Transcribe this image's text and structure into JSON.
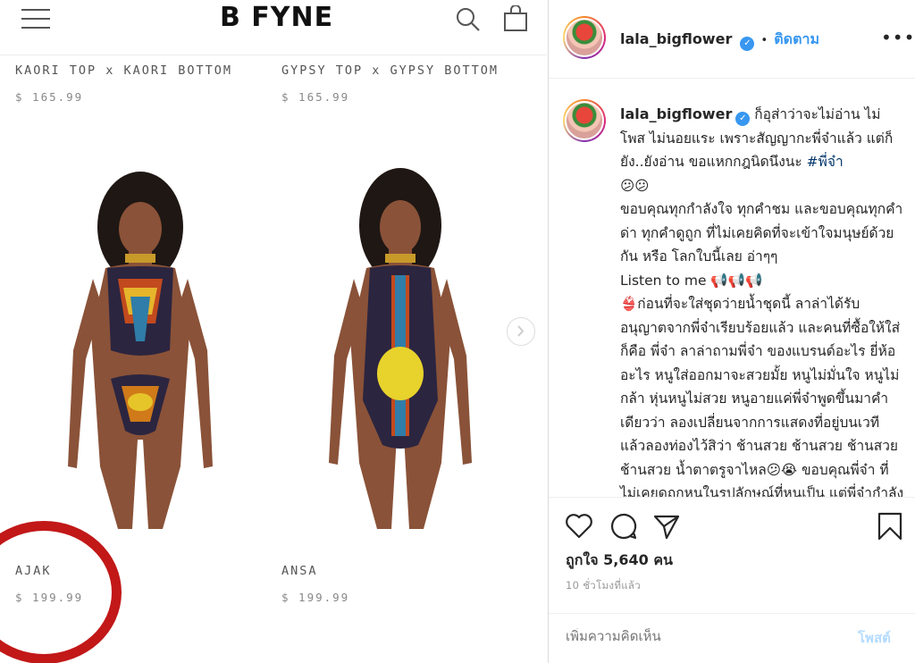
{
  "store": {
    "brand": "B FYNE",
    "products": [
      {
        "name": "KAORI TOP x KAORI BOTTOM",
        "price": "$ 165.99"
      },
      {
        "name": "GYPSY TOP x GYPSY BOTTOM",
        "price": "$ 165.99"
      },
      {
        "name": "AJAK",
        "price": "$ 199.99"
      },
      {
        "name": "ANSA",
        "price": "$ 199.99"
      }
    ],
    "highlight_color": "#c21818"
  },
  "instagram": {
    "username": "lala_bigflower",
    "follow_label": "ติดตาม",
    "separator": "•",
    "more_icon": "•••",
    "caption": {
      "username": "lala_bigflower",
      "lines": [
        "ก็อุส่าว่าจะไม่อ่าน ไม่โพส ไม่นอยแระ เพราะสัญญากะพี่จ๋าแล้ว แต่ก็ยัง..ยังอ่าน ขอแหกกฎนิดนึงนะ ",
        "#พี่จ๋า",
        "😕😕",
        "ขอบคุณทุกกำลังใจ ทุกคำชม และขอบคุณทุกคำด่า ทุกคำดูถูก ที่ไม่เคยคิดที่จะเข้าใจมนุษย์ด้วยกัน หรือ โลกใบนี้เลย อ่าๆๆ",
        "Listen to me 📢📢📢",
        "👙ก่อนที่จะใส่ชุดว่ายน้ำชุดนี้ ลาล่าได้รับอนุญาตจากพี่จ๋าเรียบร้อยแล้ว และคนที่ซื้อให้ใส่ ก็คือ พี่จ๋า ลาล่าถามพี่จ๋า ของแบรนด์อะไร ยี่ห้ออะไร หนูใส่ออกมาจะสวยมั้ย หนูไม่มั่นใจ หนูไม่กล้า หุ่นหนูไม่สวย หนูอายแค่พี่จ๋าพูดขึ้นมาคำเดียวว่า ลองเปลี่ยนจากการแสดงที่อยู่บนเวที แล้วลองท่องไว้สิว่า ช้านสวย ช้านสวย ช้านสวย ช้านสวย น้ำตาตรูจาไหล😕😭 ขอบคุณพี่จ๋า ที่ไม่เคยดูถูกหนูในรูปลักษณ์ที่หนูเป็น แต่พี่จ๋ากำลังพยายามลบคำสบประหม่าคนให้หนู และ"
      ]
    },
    "likes": "ถูกใจ 5,640 คน",
    "time_ago": "10 ชั่วโมงที่แล้ว",
    "comment_placeholder": "เพิ่มความคิดเห็น",
    "post_label": "โพสต์",
    "colors": {
      "link": "#3897f0",
      "hashtag": "#003569",
      "verified": "#3897f0"
    }
  }
}
